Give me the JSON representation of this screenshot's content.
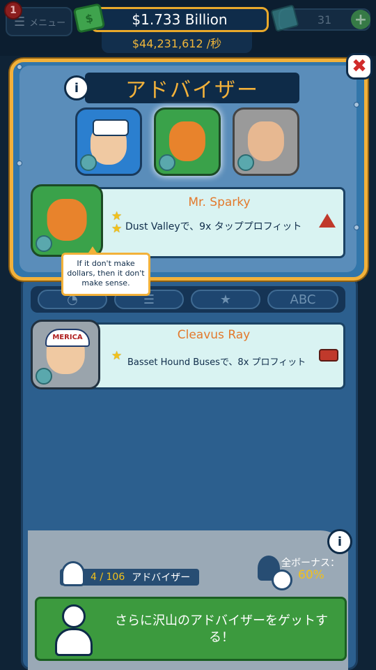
{
  "topbar": {
    "menu_label": "メニュー",
    "menu_badge": "1",
    "money": "$1.733 Billion",
    "rate": "$44,231,612 /秒",
    "gems": "31",
    "gem_plus": "+"
  },
  "modal": {
    "title": "アドバイザー",
    "info": "i",
    "close": "✖",
    "featured": {
      "name": "Mr. Sparky",
      "description": "Dust Valleyで、9x タッププロフィット",
      "tooltip": "If it don't make dollars, then it don't make sense."
    }
  },
  "sort_tabs": [
    "ABC"
  ],
  "advisors": [
    {
      "name": "Cleavus Ray",
      "description": "Basset Hound Busesで、8x プロフィット",
      "hat_text": "MERICA"
    }
  ],
  "footer": {
    "count": "4 / 106",
    "count_label": "アドバイザー",
    "bonus_label": "全ボーナス：",
    "bonus_value": "60%",
    "get_more": "さらに沢山のアドバイザーをゲットする！",
    "info": "i"
  },
  "colors": {
    "gold": "#f2b13a",
    "orange_name": "#e3792c",
    "green_button": "#3c9a3e"
  },
  "icons": [
    "menu-icon",
    "money-icon",
    "gem-icon",
    "info-icon",
    "close-icon",
    "star-icon",
    "desert-icon",
    "bus-icon",
    "advisor-silhouette-icon",
    "globe-icon"
  ]
}
